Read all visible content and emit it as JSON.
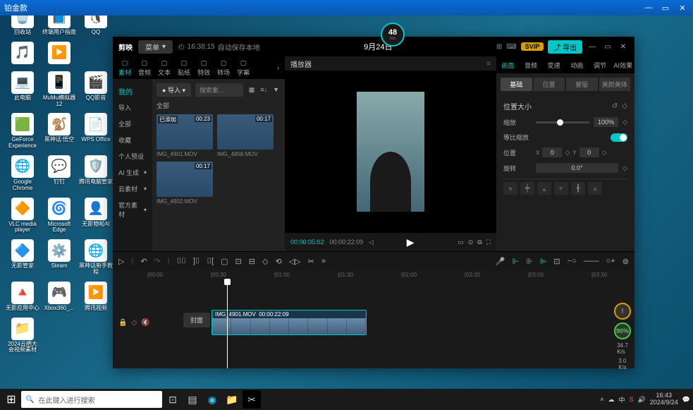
{
  "window": {
    "title": "铂金款"
  },
  "ping": {
    "value": "48",
    "unit": "ms"
  },
  "desktop_icons": [
    {
      "label": "回收站",
      "emoji": "🗑️"
    },
    {
      "label": "终端用户指南",
      "emoji": "📘"
    },
    {
      "label": "QQ",
      "emoji": "🐧"
    },
    {
      "label": "",
      "emoji": "🎵"
    },
    {
      "label": "",
      "emoji": "▶️"
    },
    {
      "label": "",
      "emoji": ""
    },
    {
      "label": "此电脑",
      "emoji": "💻"
    },
    {
      "label": "MuMu模拟器12",
      "emoji": "📱"
    },
    {
      "label": "QQ影音",
      "emoji": "🎬"
    },
    {
      "label": "GeForce Experience",
      "emoji": "🟩"
    },
    {
      "label": "黑神话:悟空",
      "emoji": "🐒"
    },
    {
      "label": "WPS Office",
      "emoji": "📄"
    },
    {
      "label": "Google Chrome",
      "emoji": "🌐"
    },
    {
      "label": "钉钉",
      "emoji": "💬"
    },
    {
      "label": "腾讯电脑管家",
      "emoji": "🛡️"
    },
    {
      "label": "VLC media player",
      "emoji": "🔶"
    },
    {
      "label": "Microsoft Edge",
      "emoji": "🌀"
    },
    {
      "label": "无影物啦AI",
      "emoji": "👤"
    },
    {
      "label": "无影管家",
      "emoji": "🔷"
    },
    {
      "label": "Steam",
      "emoji": "⚙️"
    },
    {
      "label": "黑神话新手教程",
      "emoji": "🌐"
    },
    {
      "label": "无影应用中心",
      "emoji": "🔺"
    },
    {
      "label": "Xbox360_...",
      "emoji": "🎮"
    },
    {
      "label": "腾讯视频",
      "emoji": "▶️"
    },
    {
      "label": "2024云栖大会视频素材",
      "emoji": "📁"
    },
    {
      "label": "",
      "emoji": ""
    },
    {
      "label": "",
      "emoji": ""
    }
  ],
  "app": {
    "logo": "剪映",
    "menu": "菜单",
    "autosave_time": "16:38:15",
    "autosave_label": "自动保存本地",
    "title": "9月24日",
    "svip": "SVIP",
    "export": "导出"
  },
  "top_tabs": [
    {
      "label": "素材",
      "active": true
    },
    {
      "label": "音频"
    },
    {
      "label": "文本"
    },
    {
      "label": "贴纸"
    },
    {
      "label": "特效"
    },
    {
      "label": "转场"
    },
    {
      "label": "字幕"
    }
  ],
  "left_nav": {
    "header": "我的",
    "items": [
      {
        "label": "导入"
      },
      {
        "label": "全部"
      },
      {
        "label": "收藏"
      },
      {
        "label": "个人预设"
      },
      {
        "label": "AI 生成",
        "chev": true
      },
      {
        "label": "云素材",
        "chev": true
      },
      {
        "label": "官方素材",
        "chev": true
      }
    ]
  },
  "media": {
    "import": "导入",
    "search_placeholder": "搜索素...",
    "all": "全部",
    "clips": [
      {
        "name": "IMG_4901.MOV",
        "dur": "00:23",
        "added": "已添加"
      },
      {
        "name": "IMG_4858.MOV",
        "dur": "00:17"
      },
      {
        "name": "IMG_4902.MOV",
        "dur": "00:17"
      }
    ]
  },
  "player": {
    "title": "播放器",
    "tc_current": "00:00:05:02",
    "tc_total": "00:00:22:09"
  },
  "right": {
    "tabs": [
      {
        "label": "画面",
        "active": true
      },
      {
        "label": "音频"
      },
      {
        "label": "变速"
      },
      {
        "label": "动画"
      },
      {
        "label": "调节"
      },
      {
        "label": "AI效果"
      }
    ],
    "sub_tabs": [
      {
        "label": "基础",
        "active": true
      },
      {
        "label": "位置"
      },
      {
        "label": "蒙版"
      },
      {
        "label": "美颜美体"
      }
    ],
    "section_title": "位置大小",
    "scale_label": "缩放",
    "scale_value": "100%",
    "ratio_scale_label": "等比缩放",
    "position_label": "位置",
    "pos_x": "0",
    "pos_y": "0",
    "rotate_label": "旋转",
    "rotate_value": "0.0°"
  },
  "timeline": {
    "marks": [
      "|00:00",
      "|00:30",
      "|01:00",
      "|01:30",
      "|02:00",
      "|02:30",
      "|03:00",
      "|03:30"
    ],
    "cover": "封面",
    "clip_name": "IMG_4901.MOV",
    "clip_dur": "00:00:22:09",
    "perf": {
      "p1": "90%",
      "p2_a": "34.7",
      "p2_b": "K/s",
      "p3_a": "3.0",
      "p3_b": "K/s"
    }
  },
  "taskbar": {
    "search": "在此键入进行搜索",
    "time": "16:43",
    "date": "2024/9/24"
  }
}
